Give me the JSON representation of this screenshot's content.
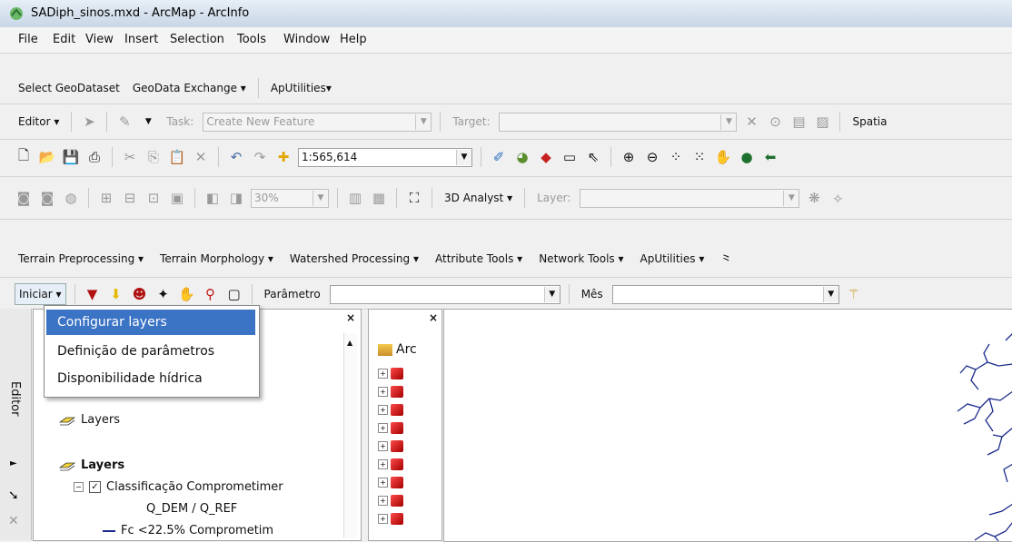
{
  "window": {
    "title": "SADiph_sinos.mxd - ArcMap - ArcInfo"
  },
  "menubar": [
    "File",
    "Edit",
    "View",
    "Insert",
    "Selection",
    "Tools",
    "Window",
    "Help"
  ],
  "toolbar_geodata": {
    "select": "Select GeoDataset",
    "exchange": "GeoData Exchange",
    "aputil": "ApUtilities"
  },
  "toolbar_editor": {
    "editor": "Editor",
    "task_label": "Task:",
    "task_value": "Create New Feature",
    "target_label": "Target:",
    "spatial": "Spatia"
  },
  "toolbar_standard": {
    "scale": "1:565,614"
  },
  "toolbar_3d": {
    "zoom": "30%",
    "analyst": "3D Analyst",
    "layer_label": "Layer:"
  },
  "toolbar_hydro": {
    "items": [
      "Terrain Preprocessing",
      "Terrain Morphology",
      "Watershed Processing",
      "Attribute Tools",
      "Network Tools",
      "ApUtilities"
    ]
  },
  "toolbar_sad": {
    "iniciar": "Iniciar",
    "param_label": "Parâmetro",
    "mes_label": "Mês"
  },
  "dropdown": {
    "items": [
      "Configurar layers",
      "Definição de parâmetros",
      "Disponibilidade hídrica"
    ]
  },
  "side_tab": {
    "label": "Editor"
  },
  "toc": {
    "layers1": "Layers",
    "layers2": "Layers",
    "class_item": "Classificação Comprometimer",
    "sub1": "Q_DEM / Q_REF",
    "sub2": "Fc <22.5% Comprometim"
  },
  "catalog": {
    "title": "Arc"
  },
  "colors": {
    "menu_highlight": "#3b73c5",
    "river": "#1a2a8c"
  }
}
